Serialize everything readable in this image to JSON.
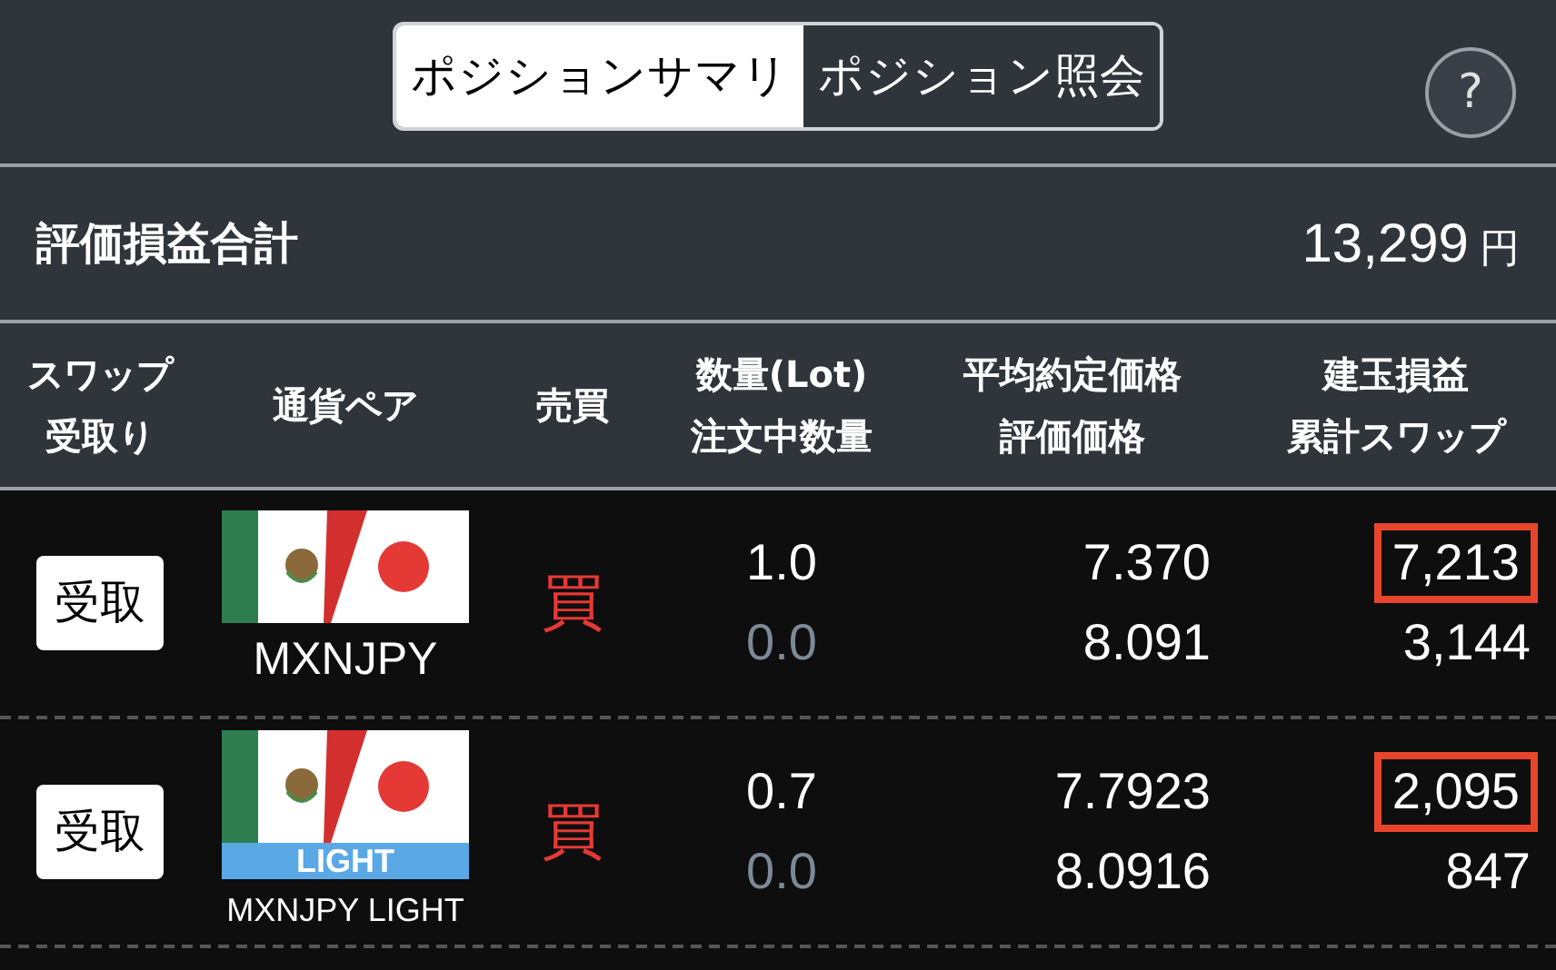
{
  "tabs": [
    {
      "label": "ポジションサマリ",
      "selected": true
    },
    {
      "label": "ポジション照会",
      "selected": false
    }
  ],
  "help_button": "?",
  "summary": {
    "label": "評価損益合計",
    "value": "13,299",
    "unit": "円"
  },
  "table": {
    "columns": [
      [
        "スワップ",
        "受取り"
      ],
      [
        "通貨ペア"
      ],
      [
        "売買"
      ],
      [
        "数量(Lot)",
        "注文中数量"
      ],
      [
        "平均約定価格",
        "評価価格"
      ],
      [
        "建玉損益",
        "累計スワップ"
      ]
    ],
    "rows": [
      {
        "receive_button": "受取",
        "pair": "MXNJPY",
        "light": false,
        "side": "買",
        "quantity": "1.0",
        "pending_quantity": "0.0",
        "avg_price": "7.370",
        "valuation_price": "8.091",
        "pnl": "7,213",
        "pnl_highlighted": true,
        "swap": "3,144"
      },
      {
        "receive_button": "受取",
        "pair": "MXNJPY LIGHT",
        "light": true,
        "light_label": "LIGHT",
        "side": "買",
        "quantity": "0.7",
        "pending_quantity": "0.0",
        "avg_price": "7.7923",
        "valuation_price": "8.0916",
        "pnl": "2,095",
        "pnl_highlighted": true,
        "swap": "847"
      }
    ]
  }
}
